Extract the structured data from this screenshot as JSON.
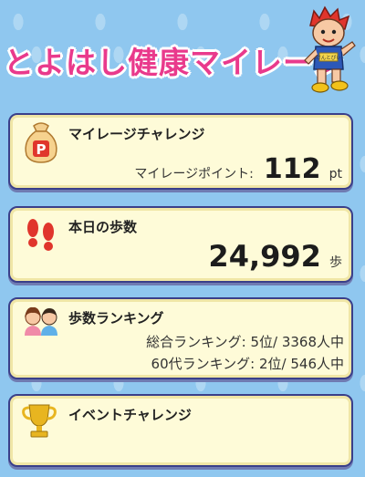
{
  "header": {
    "logo_text": "とよはし健康マイレージ",
    "mascot_badge": "けんとぴぃ"
  },
  "mileage": {
    "title": "マイレージチャレンジ",
    "points_label": "マイレージポイント:",
    "points_value": "112",
    "points_unit": "pt",
    "bag_letter": "P"
  },
  "steps": {
    "title": "本日の歩数",
    "value": "24,992",
    "unit": "歩"
  },
  "ranking": {
    "title": "歩数ランキング",
    "overall": "総合ランキング: 5位/ 3368人中",
    "age_group": "60代ランキング: 2位/ 546人中"
  },
  "event": {
    "title": "イベントチャレンジ"
  },
  "colors": {
    "background": "#8fc7ef",
    "card_bg": "#fefbd8",
    "card_border": "#3a3f8a",
    "logo": "#e93a8c",
    "accent_red": "#e0352c",
    "trophy": "#e8b520"
  }
}
